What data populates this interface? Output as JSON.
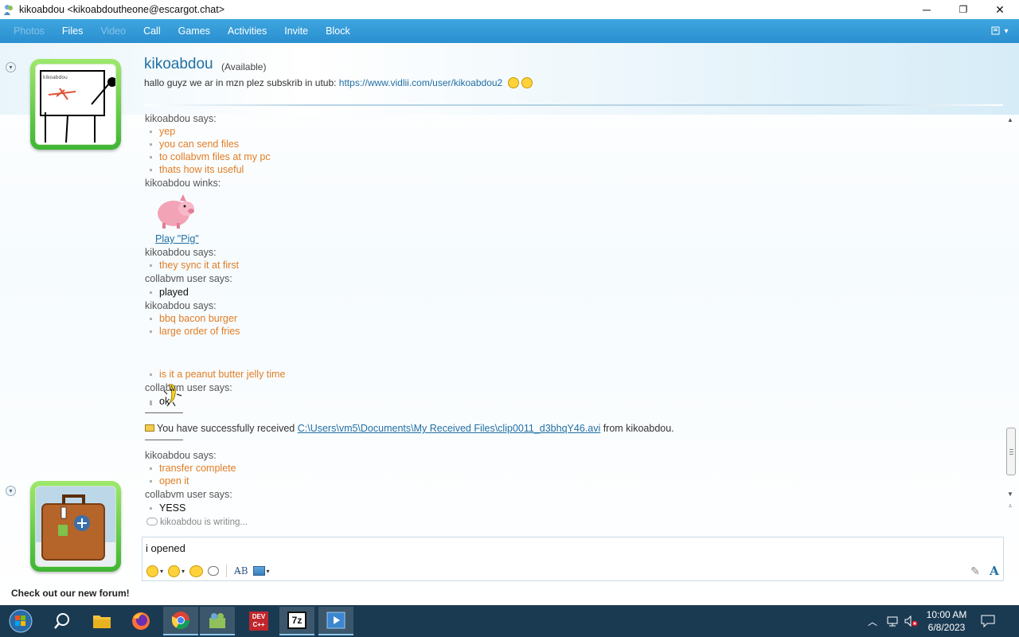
{
  "window": {
    "title": "kikoabdou <kikoabdoutheone@escargot.chat>",
    "minimize": "─",
    "restore": "❐",
    "close": "✕"
  },
  "toolbar": {
    "items": [
      {
        "label": "Photos",
        "enabled": false
      },
      {
        "label": "Files",
        "enabled": true
      },
      {
        "label": "Video",
        "enabled": false
      },
      {
        "label": "Call",
        "enabled": true
      },
      {
        "label": "Games",
        "enabled": true
      },
      {
        "label": "Activities",
        "enabled": true
      },
      {
        "label": "Invite",
        "enabled": true
      },
      {
        "label": "Block",
        "enabled": true
      }
    ]
  },
  "contact": {
    "name": "kikoabdou",
    "status": "(Available)",
    "psm_text": "hallo guyz we ar in mzn plez subskrib in utub: ",
    "psm_link": "https://www.vidlii.com/user/kikoabdou2",
    "avatar_caption": "kikoabdou"
  },
  "conversation": {
    "s1": "kikoabdou says:",
    "m1": "yep",
    "m2": "you can send files",
    "m3": "to collabvm files at my pc",
    "m4": "thats how its useful",
    "wink_sender": "kikoabdou winks:",
    "wink_link": "Play \"Pig\"",
    "s2": "kikoabdou says:",
    "m5": "they sync it at first",
    "s3": "collabvm user says:",
    "m6": "played",
    "s4": "kikoabdou says:",
    "m7": "bbq bacon burger",
    "m8": "large order of fries",
    "m9": "is it a peanut butter jelly time",
    "s5": "collabvm user says:",
    "m10": "ok",
    "file_prefix": "You have successfully received ",
    "file_path": "C:\\Users\\vm5\\Documents\\My Received Files\\clip0011_d3bhqY46.avi",
    "file_suffix": " from kikoabdou.",
    "s6": "kikoabdou says:",
    "m11": "transfer complete",
    "m12": "open it",
    "s7": "collabvm user says:",
    "m13": "YESS",
    "typing": "kikoabdou is writing..."
  },
  "input": {
    "text": "i opened"
  },
  "footer": {
    "ad": "Check out our new forum!"
  },
  "taskbar": {
    "time": "10:00 AM",
    "date": "6/8/2023",
    "apps": [
      "start",
      "search",
      "file-explorer",
      "firefox",
      "chrome",
      "msn-messenger",
      "dev-cpp",
      "7zip",
      "app"
    ]
  },
  "colors": {
    "accent": "#2b8fd0",
    "name": "#1f6fa3",
    "message": "#e27d25",
    "frame_green": "#3fb534",
    "taskbar": "#1a3a52"
  }
}
